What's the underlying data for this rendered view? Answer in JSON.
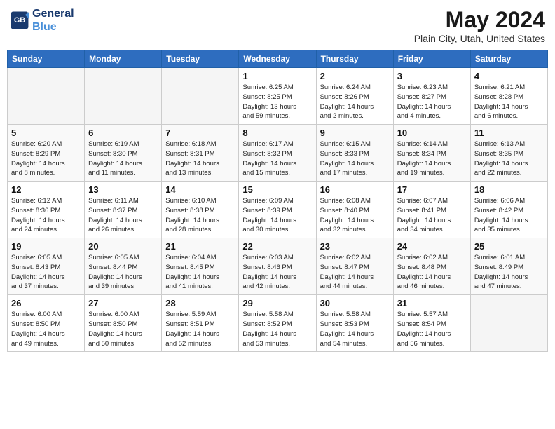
{
  "header": {
    "logo_line1": "General",
    "logo_line2": "Blue",
    "month": "May 2024",
    "location": "Plain City, Utah, United States"
  },
  "weekdays": [
    "Sunday",
    "Monday",
    "Tuesday",
    "Wednesday",
    "Thursday",
    "Friday",
    "Saturday"
  ],
  "weeks": [
    [
      {
        "day": "",
        "info": ""
      },
      {
        "day": "",
        "info": ""
      },
      {
        "day": "",
        "info": ""
      },
      {
        "day": "1",
        "info": "Sunrise: 6:25 AM\nSunset: 8:25 PM\nDaylight: 13 hours\nand 59 minutes."
      },
      {
        "day": "2",
        "info": "Sunrise: 6:24 AM\nSunset: 8:26 PM\nDaylight: 14 hours\nand 2 minutes."
      },
      {
        "day": "3",
        "info": "Sunrise: 6:23 AM\nSunset: 8:27 PM\nDaylight: 14 hours\nand 4 minutes."
      },
      {
        "day": "4",
        "info": "Sunrise: 6:21 AM\nSunset: 8:28 PM\nDaylight: 14 hours\nand 6 minutes."
      }
    ],
    [
      {
        "day": "5",
        "info": "Sunrise: 6:20 AM\nSunset: 8:29 PM\nDaylight: 14 hours\nand 8 minutes."
      },
      {
        "day": "6",
        "info": "Sunrise: 6:19 AM\nSunset: 8:30 PM\nDaylight: 14 hours\nand 11 minutes."
      },
      {
        "day": "7",
        "info": "Sunrise: 6:18 AM\nSunset: 8:31 PM\nDaylight: 14 hours\nand 13 minutes."
      },
      {
        "day": "8",
        "info": "Sunrise: 6:17 AM\nSunset: 8:32 PM\nDaylight: 14 hours\nand 15 minutes."
      },
      {
        "day": "9",
        "info": "Sunrise: 6:15 AM\nSunset: 8:33 PM\nDaylight: 14 hours\nand 17 minutes."
      },
      {
        "day": "10",
        "info": "Sunrise: 6:14 AM\nSunset: 8:34 PM\nDaylight: 14 hours\nand 19 minutes."
      },
      {
        "day": "11",
        "info": "Sunrise: 6:13 AM\nSunset: 8:35 PM\nDaylight: 14 hours\nand 22 minutes."
      }
    ],
    [
      {
        "day": "12",
        "info": "Sunrise: 6:12 AM\nSunset: 8:36 PM\nDaylight: 14 hours\nand 24 minutes."
      },
      {
        "day": "13",
        "info": "Sunrise: 6:11 AM\nSunset: 8:37 PM\nDaylight: 14 hours\nand 26 minutes."
      },
      {
        "day": "14",
        "info": "Sunrise: 6:10 AM\nSunset: 8:38 PM\nDaylight: 14 hours\nand 28 minutes."
      },
      {
        "day": "15",
        "info": "Sunrise: 6:09 AM\nSunset: 8:39 PM\nDaylight: 14 hours\nand 30 minutes."
      },
      {
        "day": "16",
        "info": "Sunrise: 6:08 AM\nSunset: 8:40 PM\nDaylight: 14 hours\nand 32 minutes."
      },
      {
        "day": "17",
        "info": "Sunrise: 6:07 AM\nSunset: 8:41 PM\nDaylight: 14 hours\nand 34 minutes."
      },
      {
        "day": "18",
        "info": "Sunrise: 6:06 AM\nSunset: 8:42 PM\nDaylight: 14 hours\nand 35 minutes."
      }
    ],
    [
      {
        "day": "19",
        "info": "Sunrise: 6:05 AM\nSunset: 8:43 PM\nDaylight: 14 hours\nand 37 minutes."
      },
      {
        "day": "20",
        "info": "Sunrise: 6:05 AM\nSunset: 8:44 PM\nDaylight: 14 hours\nand 39 minutes."
      },
      {
        "day": "21",
        "info": "Sunrise: 6:04 AM\nSunset: 8:45 PM\nDaylight: 14 hours\nand 41 minutes."
      },
      {
        "day": "22",
        "info": "Sunrise: 6:03 AM\nSunset: 8:46 PM\nDaylight: 14 hours\nand 42 minutes."
      },
      {
        "day": "23",
        "info": "Sunrise: 6:02 AM\nSunset: 8:47 PM\nDaylight: 14 hours\nand 44 minutes."
      },
      {
        "day": "24",
        "info": "Sunrise: 6:02 AM\nSunset: 8:48 PM\nDaylight: 14 hours\nand 46 minutes."
      },
      {
        "day": "25",
        "info": "Sunrise: 6:01 AM\nSunset: 8:49 PM\nDaylight: 14 hours\nand 47 minutes."
      }
    ],
    [
      {
        "day": "26",
        "info": "Sunrise: 6:00 AM\nSunset: 8:50 PM\nDaylight: 14 hours\nand 49 minutes."
      },
      {
        "day": "27",
        "info": "Sunrise: 6:00 AM\nSunset: 8:50 PM\nDaylight: 14 hours\nand 50 minutes."
      },
      {
        "day": "28",
        "info": "Sunrise: 5:59 AM\nSunset: 8:51 PM\nDaylight: 14 hours\nand 52 minutes."
      },
      {
        "day": "29",
        "info": "Sunrise: 5:58 AM\nSunset: 8:52 PM\nDaylight: 14 hours\nand 53 minutes."
      },
      {
        "day": "30",
        "info": "Sunrise: 5:58 AM\nSunset: 8:53 PM\nDaylight: 14 hours\nand 54 minutes."
      },
      {
        "day": "31",
        "info": "Sunrise: 5:57 AM\nSunset: 8:54 PM\nDaylight: 14 hours\nand 56 minutes."
      },
      {
        "day": "",
        "info": ""
      }
    ]
  ]
}
